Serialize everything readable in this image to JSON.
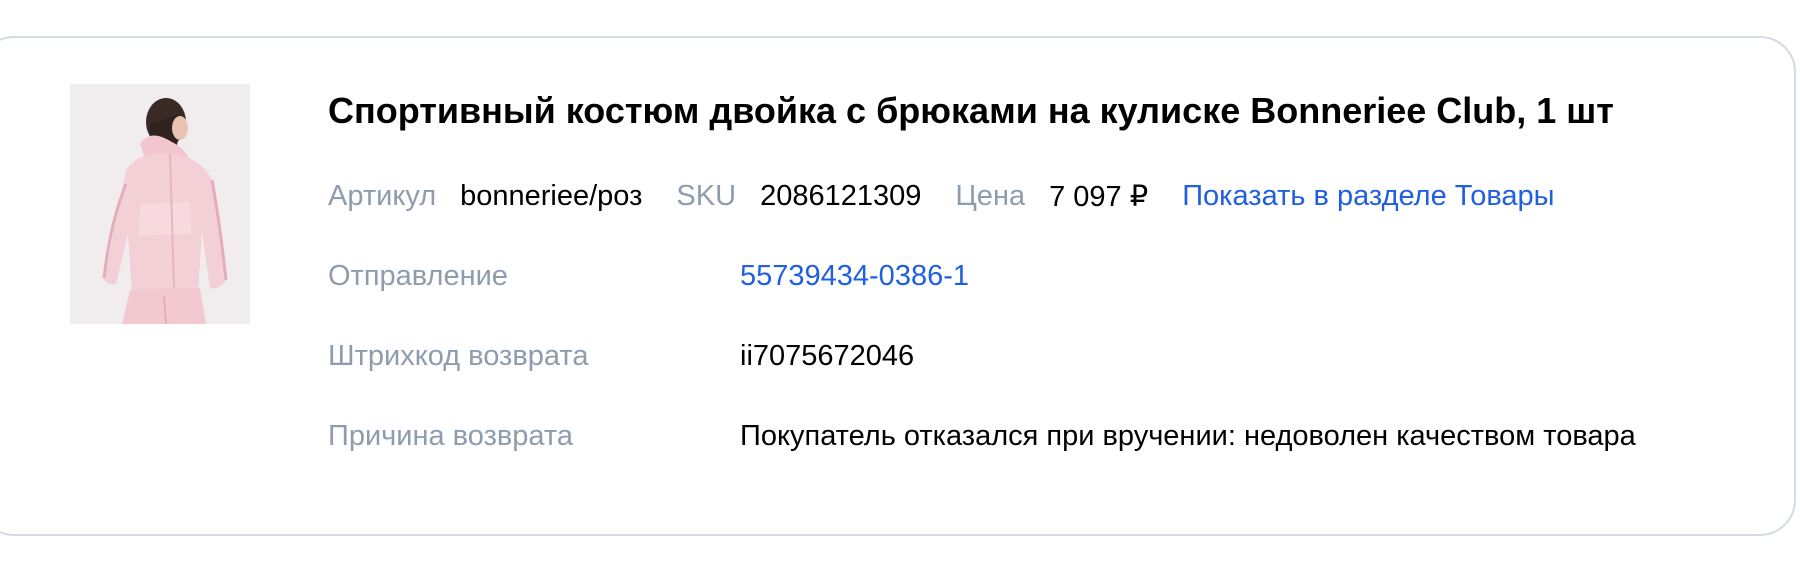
{
  "product": {
    "title": "Спортивный костюм двойка с брюками на кулиске Bonneriee Club, 1 шт",
    "image_icon": "product-photo-pink-tracksuit"
  },
  "meta": {
    "article_label": "Артикул",
    "article_value": "bonneriee/роз",
    "sku_label": "SKU",
    "sku_value": "2086121309",
    "price_label": "Цена",
    "price_value": "7 097 ₽",
    "show_link": "Показать в разделе Товары"
  },
  "details": {
    "shipment_label": "Отправление",
    "shipment_value": "55739434-0386-1",
    "barcode_label": "Штрихкод возврата",
    "barcode_value": "ii7075672046",
    "reason_label": "Причина возврата",
    "reason_value": "Покупатель отказался при вручении: недоволен качеством товара"
  },
  "colors": {
    "label": "#8f9cad",
    "link": "#1f5fe0",
    "border": "#d5dbe3",
    "garment": "#f3cfd6"
  }
}
